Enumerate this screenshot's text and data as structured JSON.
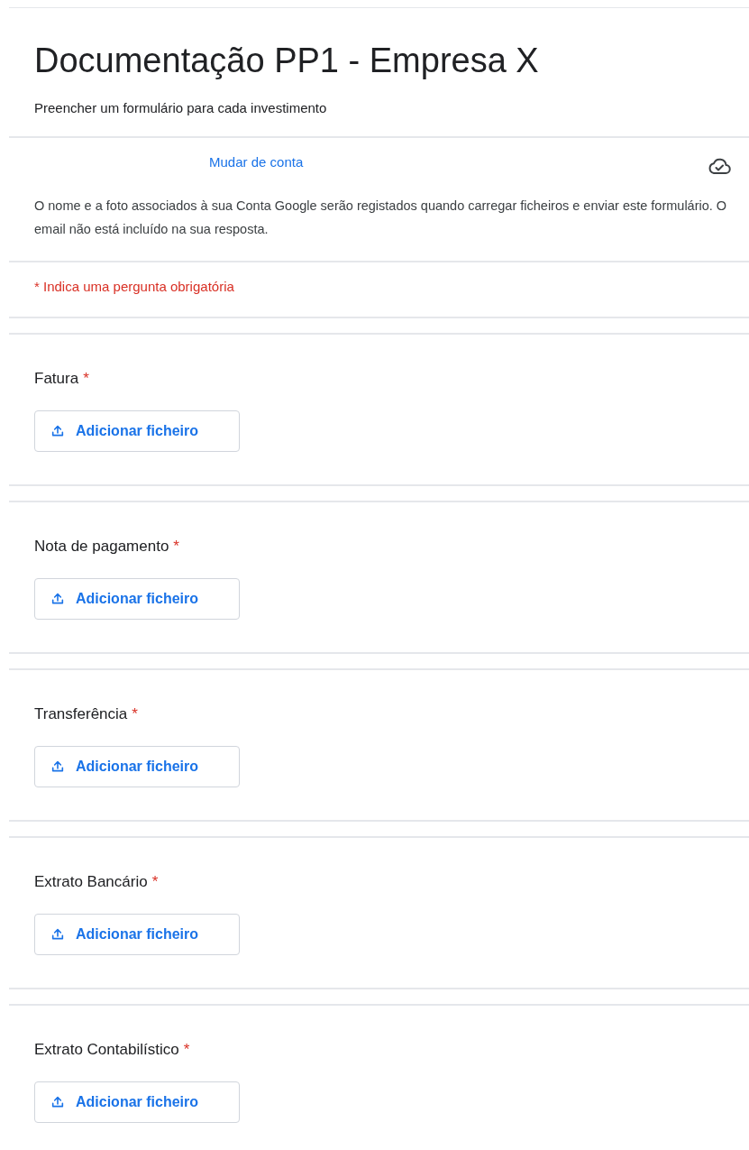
{
  "form": {
    "title": "Documentação PP1 - Empresa X",
    "description": "Preencher um formulário para cada investimento"
  },
  "account": {
    "switch_link": "Mudar de conta",
    "notice": "O nome e a foto associados à sua Conta Google serão registados quando carregar ficheiros e enviar este formulário. O email não está incluído na sua resposta."
  },
  "required_note": "* Indica uma pergunta obrigatória",
  "questions": [
    {
      "label": "Fatura",
      "required_mark": "*",
      "button": "Adicionar ficheiro"
    },
    {
      "label": "Nota de pagamento",
      "required_mark": "*",
      "button": "Adicionar ficheiro"
    },
    {
      "label": "Transferência",
      "required_mark": "*",
      "button": "Adicionar ficheiro"
    },
    {
      "label": "Extrato Bancário",
      "required_mark": "*",
      "button": "Adicionar ficheiro"
    },
    {
      "label": "Extrato Contabilístico",
      "required_mark": "*",
      "button": "Adicionar ficheiro"
    }
  ]
}
